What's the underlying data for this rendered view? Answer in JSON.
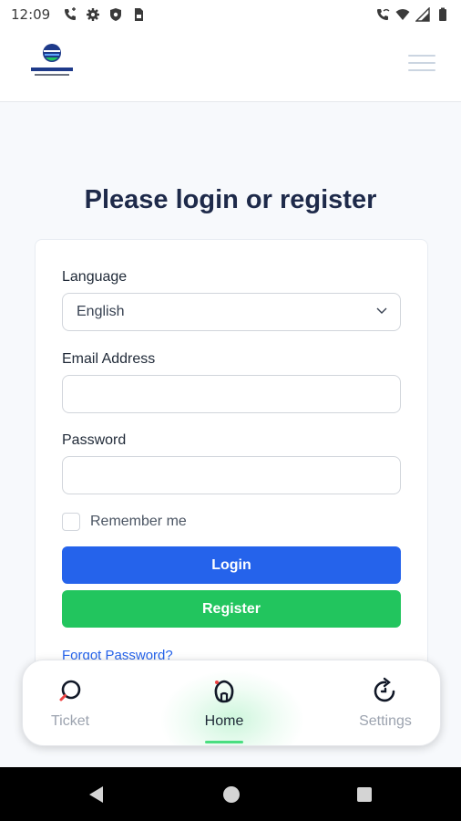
{
  "status_bar": {
    "time": "12:09",
    "left_icons": [
      "phone-icon",
      "gear-icon",
      "shield-icon",
      "sim-icon"
    ],
    "right_icons": [
      "wifi-call-icon",
      "wifi-icon",
      "signal-icon",
      "battery-icon"
    ]
  },
  "header": {
    "logo_icon": "clarion-tech-logo",
    "menu_icon": "hamburger-icon"
  },
  "page": {
    "title": "Please login or register"
  },
  "form": {
    "language_label": "Language",
    "language_value": "English",
    "email_label": "Email Address",
    "email_value": "",
    "password_label": "Password",
    "password_value": "",
    "remember_label": "Remember me",
    "remember_checked": false,
    "login_label": "Login",
    "register_label": "Register",
    "forgot_label": "Forgot Password?"
  },
  "bottom_nav": {
    "items": [
      {
        "label": "Ticket",
        "icon": "search-icon",
        "active": false
      },
      {
        "label": "Home",
        "icon": "home-icon",
        "active": true
      },
      {
        "label": "Settings",
        "icon": "refresh-icon",
        "active": false
      }
    ]
  },
  "colors": {
    "primary": "#2563eb",
    "success": "#22c55e",
    "title": "#1e2a4a",
    "active_indicator": "#4ade80"
  }
}
